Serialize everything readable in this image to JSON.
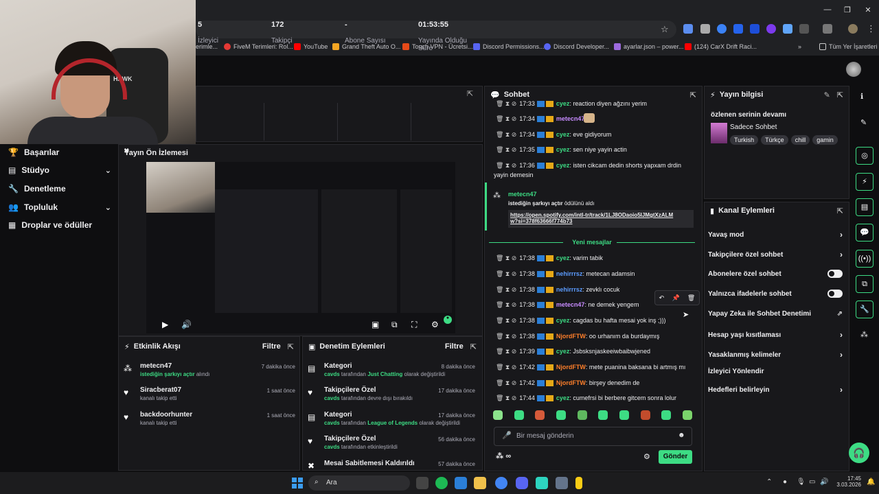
{
  "browser": {
    "bookmarks": [
      "erimle...",
      "FiveM Terimleri: Rol...",
      "YouTube",
      "Grand Theft Auto O...",
      "Touch VPN - Ücretsi...",
      "Discord Permissions...",
      "Discord Developer...",
      "ayarlar.json – power...",
      "(124) CarX Drift Raci..."
    ],
    "all_bookmarks": "Tüm Yer İşaretleri",
    "more": "»"
  },
  "cam": {
    "chair_text": "HAWK"
  },
  "nav": {
    "items": [
      {
        "label": "Başarılar",
        "icon": "trophy-icon"
      },
      {
        "label": "Stüdyo",
        "icon": "studio-icon",
        "chevron": "⌄"
      },
      {
        "label": "Denetleme",
        "icon": "wrench-icon"
      },
      {
        "label": "Topluluk",
        "icon": "community-icon",
        "chevron": "⌄"
      },
      {
        "label": "Droplar ve ödüller",
        "icon": "drops-icon"
      }
    ]
  },
  "stats": [
    {
      "value": "5",
      "label": "İzleyici"
    },
    {
      "value": "172",
      "label": "Takipçi"
    },
    {
      "value": "-",
      "label": "Abone Sayısı"
    },
    {
      "value": "01:53:55",
      "label": "Yayında Olduğu Süre"
    }
  ],
  "preview": {
    "title": "Yayın Ön İzlemesi",
    "live_dot": "●"
  },
  "activity": {
    "title": "Etkinlik Akışı",
    "filter": "Filtre",
    "items": [
      {
        "name": "metecn47",
        "sub": "istediğin şarkıyı açtır",
        "sub2": "alındı",
        "time": "7 dakika önce"
      },
      {
        "name": "Siracberat07",
        "sub": "kanalı takip etti",
        "time": "1 saat önce"
      },
      {
        "name": "backdoorhunter",
        "sub": "kanalı takip etti",
        "time": "1 saat önce"
      }
    ]
  },
  "moderation": {
    "title": "Denetim Eylemleri",
    "filter": "Filtre",
    "items": [
      {
        "name": "Kategori",
        "actor": "cavds",
        "mid": "tarafından",
        "hl": "Just Chatting",
        "end": "olarak değiştirildi",
        "time": "8 dakika önce"
      },
      {
        "name": "Takipçilere Özel",
        "actor": "cavds",
        "mid": "tarafından devre dışı bırakıldı",
        "hl": "",
        "end": "",
        "time": "17 dakika önce"
      },
      {
        "name": "Kategori",
        "actor": "cavds",
        "mid": "tarafından",
        "hl": "League of Legends",
        "end": "olarak değiştirildi",
        "time": "17 dakika önce"
      },
      {
        "name": "Takipçilere Özel",
        "actor": "cavds",
        "mid": "tarafından etkinleştirildi",
        "hl": "",
        "end": "",
        "time": "56 dakika önce"
      },
      {
        "name": "Mesai Sabitlemesi Kaldırıldı",
        "actor": "",
        "mid": "",
        "hl": "",
        "end": "",
        "time": "57 dakika önce"
      }
    ]
  },
  "chat": {
    "title": "Sohbet",
    "messages_top": [
      {
        "time": "17:33",
        "user": "cyez",
        "color": "#3ddc84",
        "text": ": reaction diyen ağzını yerim"
      },
      {
        "time": "17:34",
        "user": "metecn47",
        "color": "#c78bff",
        "text": ":"
      },
      {
        "time": "17:34",
        "user": "cyez",
        "color": "#3ddc84",
        "text": ": eve gidiyorum"
      },
      {
        "time": "17:35",
        "user": "cyez",
        "color": "#3ddc84",
        "text": ": sen niye yayin actin"
      },
      {
        "time": "17:36",
        "user": "cyez",
        "color": "#3ddc84",
        "text": ": isten cikcam dedin shorts yapxam drdin"
      }
    ],
    "wrap_text": "yayin demesin",
    "redeem": {
      "user": "metecn47",
      "line": "istediğin şarkıyı açtır",
      "line_end": "ödülünü aldı",
      "link1": "https://open.spotify.com/intl-tr/track/1LJ8ODaoio5IJMgtXzALM",
      "link2": "w?si=378f63666f774b73"
    },
    "new_messages": "Yeni mesajlar",
    "messages_new": [
      {
        "time": "17:38",
        "user": "cyez",
        "color": "#3ddc84",
        "text": ": varim tabik"
      },
      {
        "time": "17:38",
        "user": "nehirrrsz",
        "color": "#5b9bff",
        "text": ": metecan adamsin"
      },
      {
        "time": "17:38",
        "user": "nehirrrsz",
        "color": "#5b9bff",
        "text": ": zevklı cocuk"
      },
      {
        "time": "17:38",
        "user": "metecn47",
        "color": "#c78bff",
        "text": ": ne demek yengem"
      },
      {
        "time": "17:38",
        "user": "cyez",
        "color": "#3ddc84",
        "text": ": cagdas bu hafta mesai yok inş ;)))"
      },
      {
        "time": "17:38",
        "user": "NjordFTW",
        "color": "#ff7f2a",
        "text": ": oo urhanım da burdaymış"
      },
      {
        "time": "17:39",
        "user": "cyez",
        "color": "#3ddc84",
        "text": ": Jsbsksnjaskeeiwbaibwjened"
      },
      {
        "time": "17:42",
        "user": "NjordFTW",
        "color": "#ff7f2a",
        "text": ": mete puanina baksana bi artmış mı"
      },
      {
        "time": "17:42",
        "user": "NjordFTW",
        "color": "#ff7f2a",
        "text": ": birşey denedim de"
      },
      {
        "time": "17:44",
        "user": "cyez",
        "color": "#3ddc84",
        "text": ": cumefrsi bi berbere gitcem sonra lolur"
      }
    ],
    "placeholder": "Bir mesaj gönderin",
    "send": "Gönder",
    "points": "∞"
  },
  "stream_info": {
    "title": "Yayın bilgisi",
    "stream_title": "özlenen serinin devamı",
    "category": "Sadece Sohbet",
    "tags": [
      "Turkish",
      "Türkçe",
      "chill",
      "gamin"
    ]
  },
  "channel_actions": {
    "title": "Kanal Eylemleri",
    "items": [
      {
        "label": "Yavaş mod",
        "kind": "chevron"
      },
      {
        "label": "Takipçilere özel sohbet",
        "kind": "chevron"
      },
      {
        "label": "Abonelere özel sohbet",
        "kind": "toggle"
      },
      {
        "label": "Yalnızca ifadelerle sohbet",
        "kind": "toggle"
      },
      {
        "label": "Yapay Zeka ile Sohbet Denetimi",
        "kind": "external"
      },
      {
        "label": "Hesap yaşı kısıtlaması",
        "kind": "chevron"
      },
      {
        "label": "Yasaklanmış kelimeler",
        "kind": "chevron"
      },
      {
        "label": "İzleyici Yönlendir",
        "kind": "none"
      },
      {
        "label": "Hedefleri belirleyin",
        "kind": "chevron"
      }
    ]
  },
  "taskbar": {
    "search": "Ara",
    "time": "17:45",
    "date": "3.03.2026"
  },
  "colors": {
    "accent": "#3ddc84",
    "panel": "#18181b",
    "bg": "#0e0e10"
  }
}
